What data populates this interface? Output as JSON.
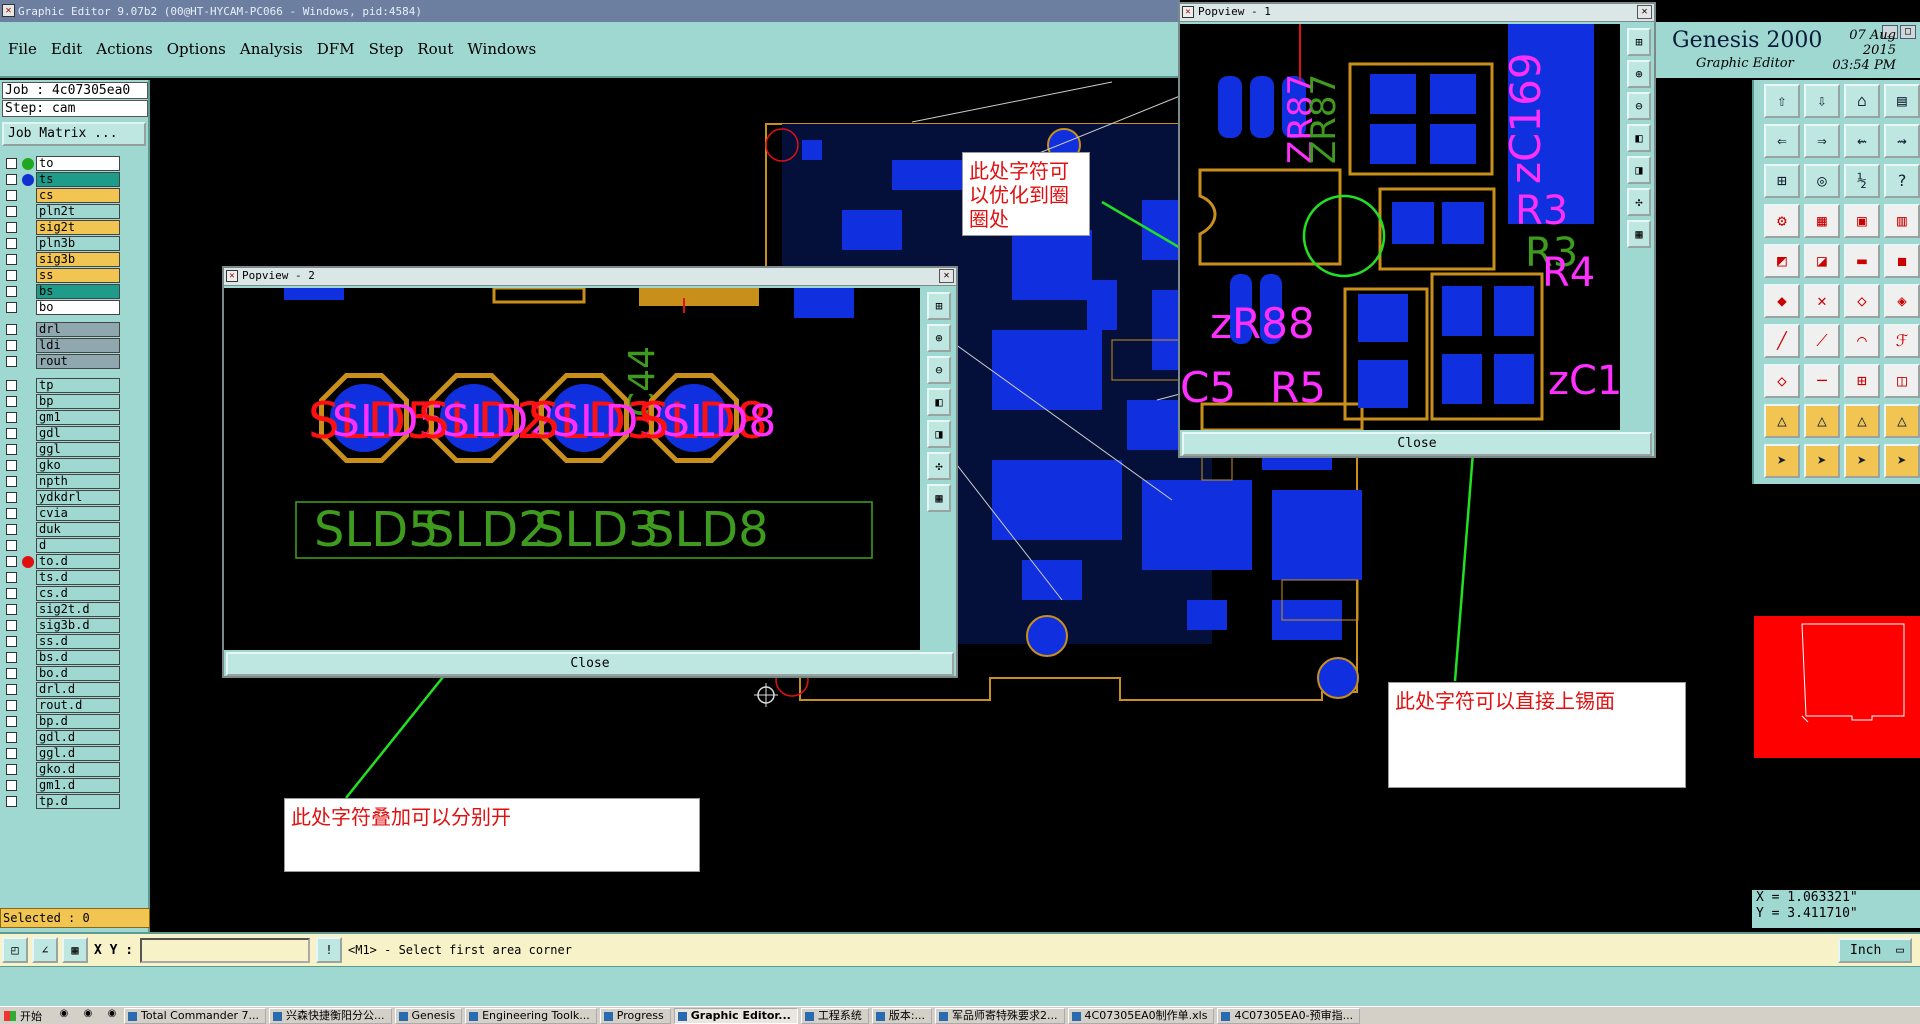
{
  "window": {
    "title": "Graphic Editor 9.07b2 (00@HT-HYCAM-PC066 - Windows, pid:4584)"
  },
  "menu": [
    "File",
    "Edit",
    "Actions",
    "Options",
    "Analysis",
    "DFM",
    "Step",
    "Rout",
    "Windows"
  ],
  "header": {
    "brand": "Genesis 2000",
    "subtitle": "Graphic Editor",
    "date": "07 Aug 2015",
    "time": "03:54 PM"
  },
  "job": {
    "job_line": "Job : 4c07305ea0",
    "step_line": "Step: cam",
    "matrix_button": "Job Matrix ..."
  },
  "layers": [
    {
      "name": "to",
      "color": "#ffffff",
      "dot": "#1fa81f"
    },
    {
      "name": "ts",
      "color": "#1f9b8a",
      "dot": "#1030d0"
    },
    {
      "name": "cs",
      "color": "#f2c552",
      "dot": ""
    },
    {
      "name": "pln2t",
      "color": "#9fd8d1",
      "dot": ""
    },
    {
      "name": "sig2t",
      "color": "#f2c552",
      "dot": ""
    },
    {
      "name": "pln3b",
      "color": "#9fd8d1",
      "dot": ""
    },
    {
      "name": "sig3b",
      "color": "#f2c552",
      "dot": ""
    },
    {
      "name": "ss",
      "color": "#f2c552",
      "dot": ""
    },
    {
      "name": "bs",
      "color": "#1f9b8a",
      "dot": ""
    },
    {
      "name": "bo",
      "color": "#ffffff",
      "dot": ""
    },
    {
      "name": "drl",
      "color": "#8fa8b0",
      "dot": ""
    },
    {
      "name": "ldi",
      "color": "#8fa8b0",
      "dot": ""
    },
    {
      "name": "rout",
      "color": "#8fa8b0",
      "dot": ""
    },
    {
      "name": "tp",
      "color": "#9fd8d1",
      "dot": ""
    },
    {
      "name": "bp",
      "color": "#9fd8d1",
      "dot": ""
    },
    {
      "name": "gm1",
      "color": "#9fd8d1",
      "dot": ""
    },
    {
      "name": "gdl",
      "color": "#9fd8d1",
      "dot": ""
    },
    {
      "name": "ggl",
      "color": "#9fd8d1",
      "dot": ""
    },
    {
      "name": "gko",
      "color": "#9fd8d1",
      "dot": ""
    },
    {
      "name": "npth",
      "color": "#9fd8d1",
      "dot": ""
    },
    {
      "name": "ydkdrl",
      "color": "#9fd8d1",
      "dot": ""
    },
    {
      "name": "cvia",
      "color": "#9fd8d1",
      "dot": ""
    },
    {
      "name": "duk",
      "color": "#9fd8d1",
      "dot": ""
    },
    {
      "name": "d",
      "color": "#9fd8d1",
      "dot": ""
    },
    {
      "name": "to.d",
      "color": "#9fd8d1",
      "dot": "#e01010"
    },
    {
      "name": "ts.d",
      "color": "#9fd8d1",
      "dot": ""
    },
    {
      "name": "cs.d",
      "color": "#9fd8d1",
      "dot": ""
    },
    {
      "name": "sig2t.d",
      "color": "#9fd8d1",
      "dot": ""
    },
    {
      "name": "sig3b.d",
      "color": "#9fd8d1",
      "dot": ""
    },
    {
      "name": "ss.d",
      "color": "#9fd8d1",
      "dot": ""
    },
    {
      "name": "bs.d",
      "color": "#9fd8d1",
      "dot": ""
    },
    {
      "name": "bo.d",
      "color": "#9fd8d1",
      "dot": ""
    },
    {
      "name": "drl.d",
      "color": "#9fd8d1",
      "dot": ""
    },
    {
      "name": "rout.d",
      "color": "#9fd8d1",
      "dot": ""
    },
    {
      "name": "bp.d",
      "color": "#9fd8d1",
      "dot": ""
    },
    {
      "name": "gdl.d",
      "color": "#9fd8d1",
      "dot": ""
    },
    {
      "name": "ggl.d",
      "color": "#9fd8d1",
      "dot": ""
    },
    {
      "name": "gko.d",
      "color": "#9fd8d1",
      "dot": ""
    },
    {
      "name": "gm1.d",
      "color": "#9fd8d1",
      "dot": ""
    },
    {
      "name": "tp.d",
      "color": "#9fd8d1",
      "dot": ""
    }
  ],
  "selected": "Selected : 0",
  "popview2": {
    "title": "Popview - 2",
    "silk_labels": [
      "SLD5",
      "SLD2",
      "SLD3",
      "SLD8"
    ],
    "pad_labels": [
      "SLD5",
      "SLD2",
      "SLD3",
      "SLD8"
    ],
    "rotated_label": "C44",
    "close": "Close"
  },
  "popview1": {
    "title": "Popview - 1",
    "labels": [
      "ZR87",
      "ZR87",
      "zC169",
      "R3",
      "R3",
      "zR88",
      "R4",
      "C5",
      "R5",
      "zC1"
    ],
    "close": "Close"
  },
  "annotations": {
    "top": "此处字符可以优化到圈圈处",
    "right": "此处字符可以直接上锡面",
    "left": "此处字符叠加可以分别开"
  },
  "coords": {
    "x": "X = 1.063321\"",
    "y": "Y = 3.411710\""
  },
  "command": {
    "xy_label": "X Y :",
    "xy_value": "",
    "prompt": "<M1> - Select first area corner",
    "unit": "Inch"
  },
  "taskbar": {
    "start": "开始",
    "tasks": [
      "Total Commander 7...",
      "兴森快捷衡阳分公...",
      "Genesis",
      "Engineering Toolk...",
      "Progress",
      "Graphic Editor...",
      "工程系统",
      "版本:...",
      "军品师寄特殊要求2...",
      "4C07305EA0制作单.xls",
      "4C07305EA0-预审指..."
    ]
  },
  "colors": {
    "panel": "#9fd8d1",
    "copper_pad": "#1030e0",
    "silkscreen": "#3e9b1e",
    "outline": "#c8901a",
    "annotation_text": "#e01010",
    "arrow": "#22e022"
  },
  "icons": [
    "gear-icon",
    "zoom-icon",
    "pan-icon",
    "select-icon",
    "measure-icon"
  ]
}
